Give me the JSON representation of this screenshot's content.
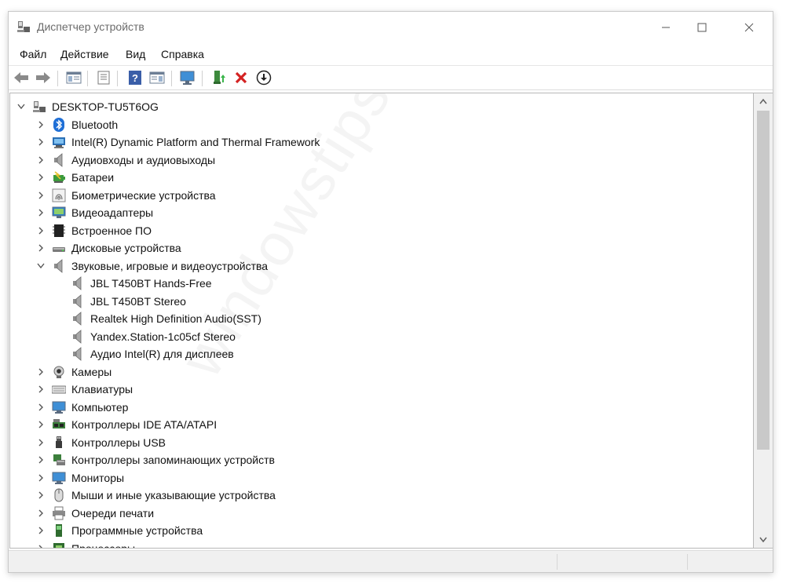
{
  "window": {
    "title": "Диспетчер устройств"
  },
  "controls": {
    "minimize": "—",
    "maximize": "☐",
    "close": "✕"
  },
  "menu": [
    "Файл",
    "Действие",
    "Вид",
    "Справка"
  ],
  "tree": {
    "root": "DESKTOP-TU5T6OG",
    "items": [
      {
        "label": "Bluetooth",
        "icon": "bluetooth-icon"
      },
      {
        "label": "Intel(R) Dynamic Platform and Thermal Framework",
        "icon": "computer-chip-icon"
      },
      {
        "label": "Аудиовходы и аудиовыходы",
        "icon": "speaker-icon"
      },
      {
        "label": "Батареи",
        "icon": "battery-icon"
      },
      {
        "label": "Биометрические устройства",
        "icon": "fingerprint-icon"
      },
      {
        "label": "Видеоадаптеры",
        "icon": "display-adapter-icon"
      },
      {
        "label": "Встроенное ПО",
        "icon": "firmware-chip-icon"
      },
      {
        "label": "Дисковые устройства",
        "icon": "disk-drive-icon"
      },
      {
        "label": "Звуковые, игровые и видеоустройства",
        "icon": "speaker-icon",
        "expanded": true
      },
      {
        "label": "JBL T450BT Hands-Free",
        "icon": "speaker-icon",
        "child": true
      },
      {
        "label": "JBL T450BT Stereo",
        "icon": "speaker-icon",
        "child": true
      },
      {
        "label": "Realtek High Definition Audio(SST)",
        "icon": "speaker-icon",
        "child": true
      },
      {
        "label": "Yandex.Station-1c05cf Stereo",
        "icon": "speaker-icon",
        "child": true
      },
      {
        "label": "Аудио Intel(R) для дисплеев",
        "icon": "speaker-icon",
        "child": true
      },
      {
        "label": "Камеры",
        "icon": "camera-icon"
      },
      {
        "label": "Клавиатуры",
        "icon": "keyboard-icon"
      },
      {
        "label": "Компьютер",
        "icon": "monitor-icon"
      },
      {
        "label": "Контроллеры IDE ATA/ATAPI",
        "icon": "ide-controller-icon"
      },
      {
        "label": "Контроллеры USB",
        "icon": "usb-icon"
      },
      {
        "label": "Контроллеры запоминающих устройств",
        "icon": "storage-controller-icon"
      },
      {
        "label": "Мониторы",
        "icon": "monitor-icon"
      },
      {
        "label": "Мыши и иные указывающие устройства",
        "icon": "mouse-icon"
      },
      {
        "label": "Очереди печати",
        "icon": "printer-icon"
      },
      {
        "label": "Программные устройства",
        "icon": "software-device-icon"
      },
      {
        "label": "Процессоры",
        "icon": "processor-icon"
      }
    ]
  },
  "watermark": "windowstips.ru"
}
